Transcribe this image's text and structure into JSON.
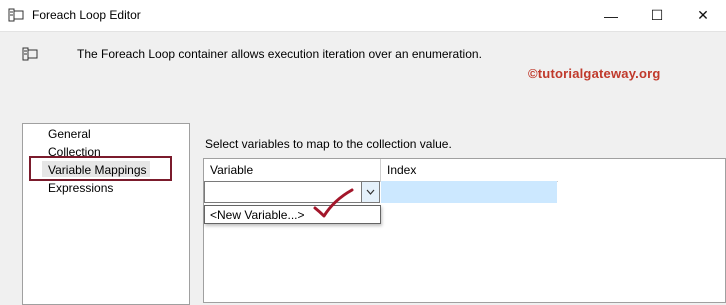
{
  "window": {
    "title": "Foreach Loop Editor",
    "minimize_glyph": "—",
    "maximize_glyph": "☐",
    "close_glyph": "✕"
  },
  "header": {
    "description": "The Foreach Loop container allows execution iteration over an enumeration."
  },
  "watermark": "©tutorialgateway.org",
  "nav": {
    "items": [
      {
        "label": "General"
      },
      {
        "label": "Collection"
      },
      {
        "label": "Variable Mappings",
        "selected": true
      },
      {
        "label": "Expressions"
      }
    ]
  },
  "main": {
    "instruction": "Select variables to map to the collection value.",
    "grid": {
      "columns": [
        "Variable",
        "Index"
      ],
      "dropdown_options": [
        "<New Variable...>"
      ]
    }
  },
  "colors": {
    "highlight_border": "#7b1b2c",
    "watermark": "#c0392b",
    "row_selection": "#cce8ff"
  },
  "icons": [
    "app-icon",
    "header-icon",
    "chevron-down-icon",
    "checkmark-icon"
  ]
}
